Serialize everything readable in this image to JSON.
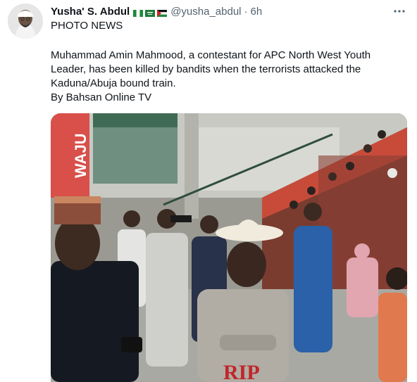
{
  "tweet": {
    "author_name": "Yusha' S. Abdul",
    "flag_icons": [
      "nigeria-flag-icon",
      "saudi-arabia-flag-icon",
      "palestine-flag-icon"
    ],
    "handle": "@yusha_abdul",
    "separator": "·",
    "time": "6h",
    "more_icon": "more-horizontal-icon",
    "heading": "PHOTO NEWS",
    "body_lines": [
      "Muhammad Amin Mahmood, a contestant for APC North West Youth",
      "Leader, has been killed by bandits when the terrorists attacked the",
      "Kaduna/Abuja bound train.",
      "By Bahsan Online TV"
    ],
    "photo": {
      "banner_text": "WAJU",
      "shirt_text": "RIP"
    }
  },
  "colors": {
    "text_primary": "#0f1419",
    "text_secondary": "#536471",
    "background": "#ffffff"
  }
}
